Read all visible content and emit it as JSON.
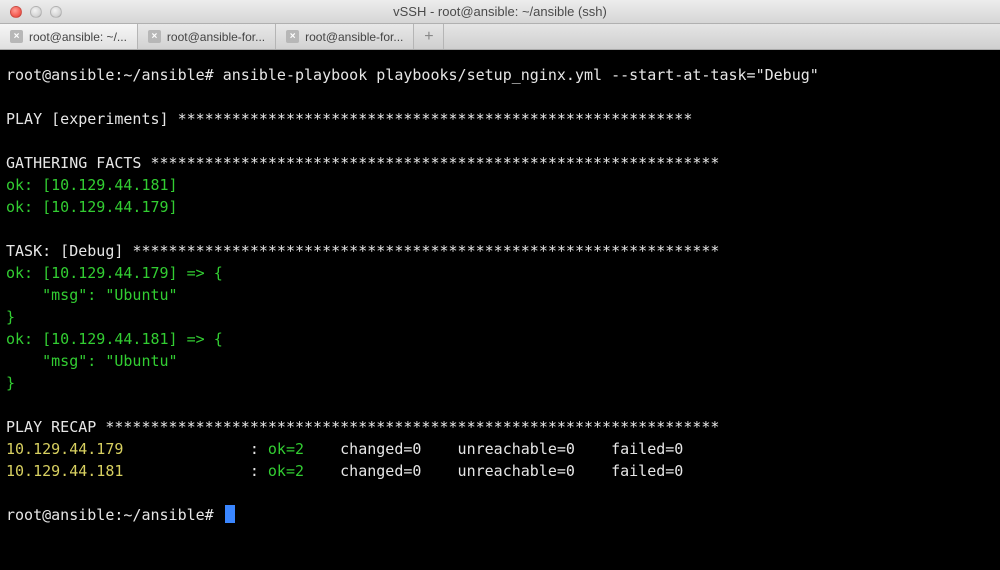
{
  "window": {
    "title": "vSSH - root@ansible: ~/ansible (ssh)"
  },
  "tabs": {
    "items": [
      {
        "label": "root@ansible: ~/...",
        "active": true
      },
      {
        "label": "root@ansible-for...",
        "active": false
      },
      {
        "label": "root@ansible-for...",
        "active": false
      }
    ],
    "new_tab_glyph": "+"
  },
  "terminal": {
    "prompt1": "root@ansible:~/ansible# ",
    "command": "ansible-playbook playbooks/setup_nginx.yml --start-at-task=\"Debug\"",
    "play_label": "PLAY [experiments] ",
    "play_stars": "*********************************************************",
    "gather_label": "GATHERING FACTS ",
    "gather_stars": "***************************************************************",
    "gather_ok1": "ok: [10.129.44.181]",
    "gather_ok2": "ok: [10.129.44.179]",
    "task_label": "TASK: [Debug] ",
    "task_stars": "*****************************************************************",
    "task_block1_l1": "ok: [10.129.44.179] => {",
    "task_block1_l2": "    \"msg\": \"Ubuntu\"",
    "task_block1_l3": "}",
    "task_block2_l1": "ok: [10.129.44.181] => {",
    "task_block2_l2": "    \"msg\": \"Ubuntu\"",
    "task_block2_l3": "}",
    "recap_label": "PLAY RECAP ",
    "recap_stars": "********************************************************************",
    "recap_row1_host": "10.129.44.179",
    "recap_row1_sep": "              : ",
    "recap_row1_ok": "ok=2",
    "recap_row1_rest": "    changed=0    unreachable=0    failed=0",
    "recap_row2_host": "10.129.44.181",
    "recap_row2_sep": "              : ",
    "recap_row2_ok": "ok=2",
    "recap_row2_rest": "    changed=0    unreachable=0    failed=0",
    "prompt2": "root@ansible:~/ansible# "
  }
}
